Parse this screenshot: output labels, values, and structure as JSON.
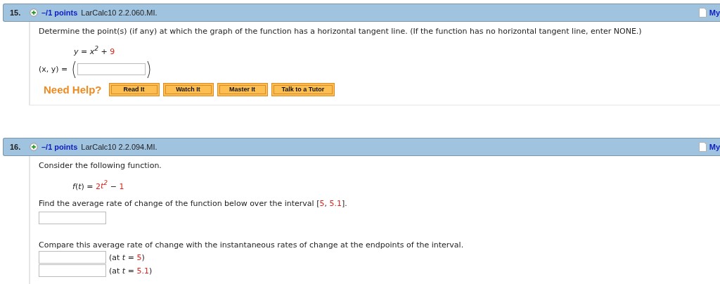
{
  "questions": [
    {
      "number": "15.",
      "points": "–/1 points",
      "source": "LarCalc10 2.2.060.MI.",
      "my_notes": "My",
      "body": [
        {
          "kind": "text",
          "segments": [
            {
              "kind": "text",
              "text": "Determine the point(s) (if any) at which the graph of the function has a horizontal tangent line. (If the function has no horizontal tangent line, enter NONE.)"
            }
          ]
        },
        {
          "kind": "equation",
          "segments": [
            {
              "kind": "var",
              "text": "y"
            },
            {
              "kind": "op",
              "text": " = "
            },
            {
              "kind": "var",
              "text": "x$^{2}$"
            },
            {
              "kind": "op",
              "text": " + "
            },
            {
              "kind": "num",
              "text": "9"
            }
          ]
        },
        {
          "kind": "point",
          "label": "(x, y) ="
        },
        {
          "kind": "help",
          "label": "Need Help?",
          "buttons": [
            "Read It",
            "Watch It",
            "Master It",
            "Talk to a Tutor"
          ]
        }
      ]
    },
    {
      "number": "16.",
      "points": "–/1 points",
      "source": "LarCalc10 2.2.094.MI.",
      "my_notes": "My",
      "body": [
        {
          "kind": "text",
          "segments": [
            {
              "kind": "text",
              "text": "Consider the following function."
            }
          ]
        },
        {
          "kind": "equation",
          "segments": [
            {
              "kind": "var",
              "text": "f"
            },
            {
              "kind": "op",
              "text": "("
            },
            {
              "kind": "var",
              "text": "t"
            },
            {
              "kind": "op",
              "text": ") = "
            },
            {
              "kind": "num",
              "text": "2"
            },
            {
              "kind": "numvar",
              "text": "t$^{2}$"
            },
            {
              "kind": "op",
              "text": " − "
            },
            {
              "kind": "num",
              "text": "1"
            }
          ]
        },
        {
          "kind": "text",
          "segments": [
            {
              "kind": "text",
              "text": "Find the average rate of change of the function below over the interval ["
            },
            {
              "kind": "num",
              "text": "5"
            },
            {
              "kind": "text",
              "text": ", "
            },
            {
              "kind": "num",
              "text": "5.1"
            },
            {
              "kind": "text",
              "text": "]."
            }
          ]
        },
        {
          "kind": "input"
        },
        {
          "kind": "spacer"
        },
        {
          "kind": "text",
          "segments": [
            {
              "kind": "text",
              "text": "Compare this average rate of change with the instantaneous rates of change at the endpoints of the interval."
            }
          ]
        },
        {
          "kind": "labeled_input",
          "segments": [
            {
              "kind": "text",
              "text": "(at "
            },
            {
              "kind": "var",
              "text": "t"
            },
            {
              "kind": "text",
              "text": " = "
            },
            {
              "kind": "num",
              "text": "5"
            },
            {
              "kind": "text",
              "text": ")"
            }
          ]
        },
        {
          "kind": "labeled_input",
          "segments": [
            {
              "kind": "text",
              "text": "(at "
            },
            {
              "kind": "var",
              "text": "t"
            },
            {
              "kind": "text",
              "text": " = "
            },
            {
              "kind": "num",
              "text": "5.1"
            },
            {
              "kind": "text",
              "text": ")"
            }
          ]
        }
      ]
    }
  ]
}
